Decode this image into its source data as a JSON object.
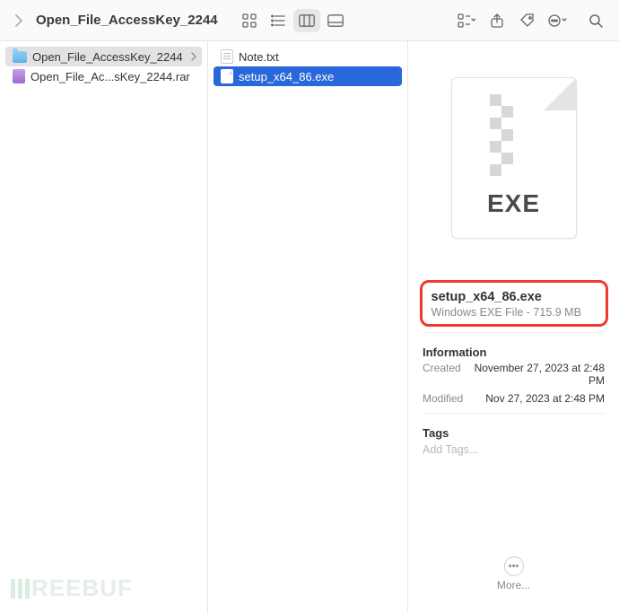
{
  "toolbar": {
    "title": "Open_File_AccessKey_2244"
  },
  "column1": {
    "items": [
      {
        "name": "Open_File_AccessKey_2244",
        "icon": "folder",
        "selected": true,
        "hasChildren": true
      },
      {
        "name": "Open_File_Ac...sKey_2244.rar",
        "icon": "rar",
        "selected": false,
        "hasChildren": false
      }
    ]
  },
  "column2": {
    "items": [
      {
        "name": "Note.txt",
        "icon": "txt",
        "selected": false
      },
      {
        "name": "setup_x64_86.exe",
        "icon": "exe",
        "selected": true
      }
    ]
  },
  "preview": {
    "exeBadge": "EXE",
    "fileName": "setup_x64_86.exe",
    "fileMeta": "Windows EXE File - 715.9 MB",
    "infoTitle": "Information",
    "createdLabel": "Created",
    "createdValue": "November 27, 2023 at 2:48 PM",
    "modifiedLabel": "Modified",
    "modifiedValue": "Nov 27, 2023 at 2:48 PM",
    "tagsTitle": "Tags",
    "tagsPlaceholder": "Add Tags...",
    "moreLabel": "More..."
  },
  "watermark": "REEBUF"
}
